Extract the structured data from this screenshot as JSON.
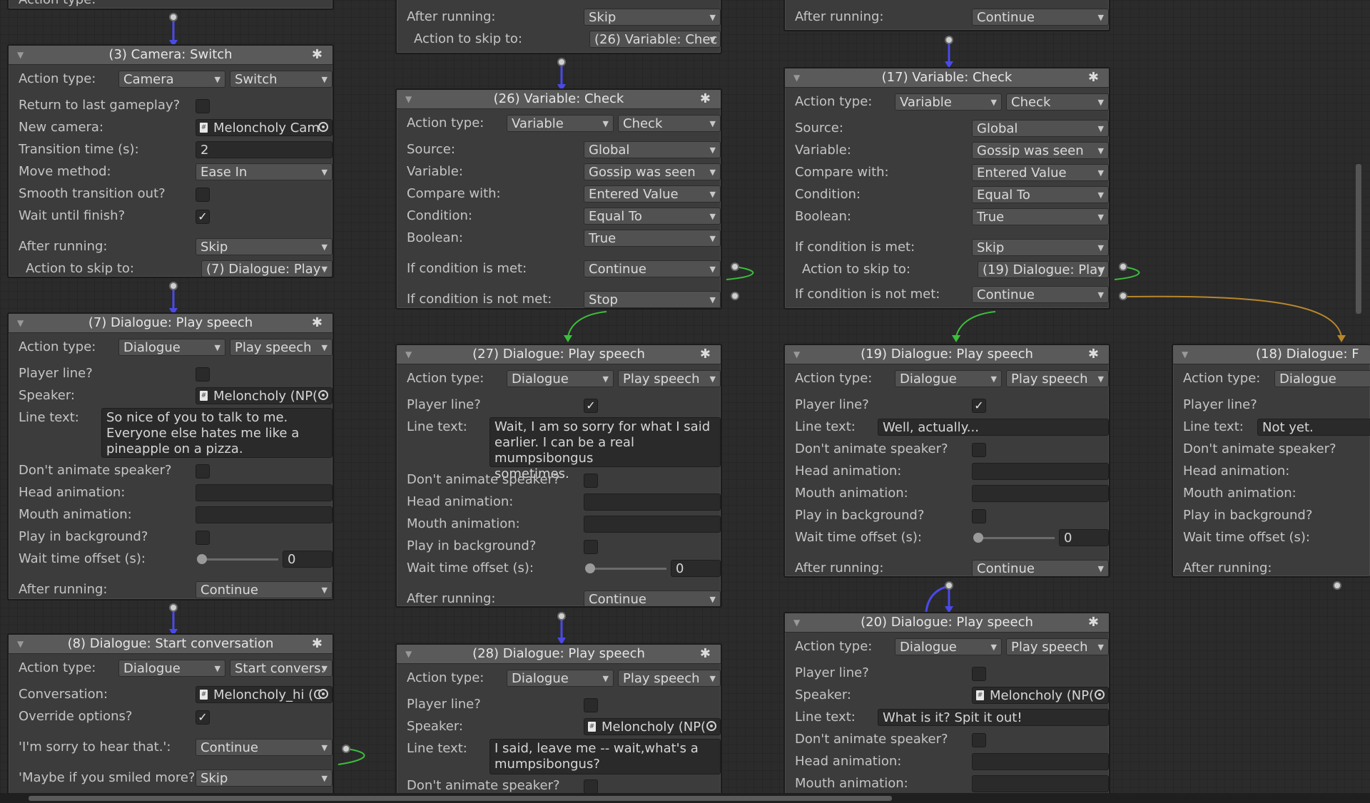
{
  "colors": {
    "flow": "#4a4ae8",
    "met": "#3bbf3b",
    "notmet": "#b8862b"
  },
  "nodes": {
    "n3": {
      "title": "(3) Camera: Switch",
      "action_type_label": "Action type:",
      "action_type": "Camera",
      "action_subtype": "Switch",
      "return_label": "Return to last gameplay?",
      "new_camera_label": "New camera:",
      "new_camera": "Meloncholy Cam",
      "transition_label": "Transition time (s):",
      "transition": "2",
      "move_label": "Move method:",
      "move": "Ease In",
      "smooth_label": "Smooth transition out?",
      "wait_label": "Wait until finish?",
      "after_label": "After running:",
      "after": "Skip",
      "skip_label": "Action to skip to:",
      "skip": "(7) Dialogue: Play"
    },
    "n7": {
      "title": "(7) Dialogue: Play speech",
      "action_type_label": "Action type:",
      "action_type": "Dialogue",
      "action_subtype": "Play speech",
      "player_label": "Player line?",
      "speaker_label": "Speaker:",
      "speaker": "Meloncholy (NP(",
      "line_label": "Line text:",
      "line": "So nice of you to talk to me.\nEveryone else hates me like a\npineapple on a pizza.",
      "dont_animate_label": "Don't animate speaker?",
      "head_label": "Head animation:",
      "mouth_label": "Mouth animation:",
      "bg_label": "Play in background?",
      "wait_offset_label": "Wait time offset (s):",
      "wait_offset": "0",
      "after_label": "After running:",
      "after": "Continue"
    },
    "n8": {
      "title": "(8) Dialogue: Start conversation",
      "action_type_label": "Action type:",
      "action_type": "Dialogue",
      "action_subtype": "Start convers:",
      "conv_label": "Conversation:",
      "conv": "Meloncholy_hi (C",
      "override_label": "Override options?",
      "opt1_label": "'I'm sorry to hear that.':",
      "opt1": "Continue",
      "opt2_label": "'Maybe if you smiled more?",
      "opt2": "Skip"
    },
    "ntop_mid": {
      "after_label": "After running:",
      "after": "Skip",
      "skip_label": "Action to skip to:",
      "skip": "(26) Variable: Chec"
    },
    "n26": {
      "title": "(26) Variable: Check",
      "action_type_label": "Action type:",
      "action_type": "Variable",
      "action_subtype": "Check",
      "source_label": "Source:",
      "source": "Global",
      "variable_label": "Variable:",
      "variable": "Gossip was seen",
      "compare_label": "Compare with:",
      "compare": "Entered Value",
      "condition_label": "Condition:",
      "condition": "Equal To",
      "boolean_label": "Boolean:",
      "boolean": "True",
      "met_label": "If condition is met:",
      "met": "Continue",
      "notmet_label": "If condition is not met:",
      "notmet": "Stop"
    },
    "n27": {
      "title": "(27) Dialogue: Play speech",
      "action_type_label": "Action type:",
      "action_type": "Dialogue",
      "action_subtype": "Play speech",
      "player_label": "Player line?",
      "line_label": "Line text:",
      "line": "Wait, I am so sorry for what I said\nearlier. I can be a real mumpsibongus\nsometimes.",
      "dont_animate_label": "Don't animate speaker?",
      "head_label": "Head animation:",
      "mouth_label": "Mouth animation:",
      "bg_label": "Play in background?",
      "wait_offset_label": "Wait time offset (s):",
      "wait_offset": "0",
      "after_label": "After running:",
      "after": "Continue"
    },
    "n28": {
      "title": "(28) Dialogue: Play speech",
      "action_type_label": "Action type:",
      "action_type": "Dialogue",
      "action_subtype": "Play speech",
      "player_label": "Player line?",
      "speaker_label": "Speaker:",
      "speaker": "Meloncholy (NP(",
      "line_label": "Line text:",
      "line": "I said, leave me -- wait,what's a\nmumpsibongus?",
      "dont_animate_label": "Don't animate speaker?"
    },
    "ntop_right": {
      "after_label": "After running:",
      "after": "Continue"
    },
    "n17": {
      "title": "(17) Variable: Check",
      "action_type_label": "Action type:",
      "action_type": "Variable",
      "action_subtype": "Check",
      "source_label": "Source:",
      "source": "Global",
      "variable_label": "Variable:",
      "variable": "Gossip was seen",
      "compare_label": "Compare with:",
      "compare": "Entered Value",
      "condition_label": "Condition:",
      "condition": "Equal To",
      "boolean_label": "Boolean:",
      "boolean": "True",
      "met_label": "If condition is met:",
      "met": "Skip",
      "skip_label": "Action to skip to:",
      "skip": "(19) Dialogue: Play",
      "notmet_label": "If condition is not met:",
      "notmet": "Continue"
    },
    "n19": {
      "title": "(19) Dialogue: Play speech",
      "action_type_label": "Action type:",
      "action_type": "Dialogue",
      "action_subtype": "Play speech",
      "player_label": "Player line?",
      "line_label": "Line text:",
      "line": "Well, actually...",
      "dont_animate_label": "Don't animate speaker?",
      "head_label": "Head animation:",
      "mouth_label": "Mouth animation:",
      "bg_label": "Play in background?",
      "wait_offset_label": "Wait time offset (s):",
      "wait_offset": "0",
      "after_label": "After running:",
      "after": "Continue"
    },
    "n20": {
      "title": "(20) Dialogue: Play speech",
      "action_type_label": "Action type:",
      "action_type": "Dialogue",
      "action_subtype": "Play speech",
      "player_label": "Player line?",
      "speaker_label": "Speaker:",
      "speaker": "Meloncholy (NP(",
      "line_label": "Line text:",
      "line": "What is it? Spit it out!",
      "dont_animate_label": "Don't animate speaker?",
      "head_label": "Head animation:",
      "mouth_label": "Mouth animation:"
    },
    "n18": {
      "title": "(18) Dialogue: F",
      "action_type_label": "Action type:",
      "action_type": "Dialogue",
      "player_label": "Player line?",
      "line_label": "Line text:",
      "line": "Not yet.",
      "dont_animate_label": "Don't animate speaker?",
      "head_label": "Head animation:",
      "mouth_label": "Mouth animation:",
      "bg_label": "Play in background?",
      "wait_offset_label": "Wait time offset (s):",
      "after_label": "After running:"
    }
  }
}
